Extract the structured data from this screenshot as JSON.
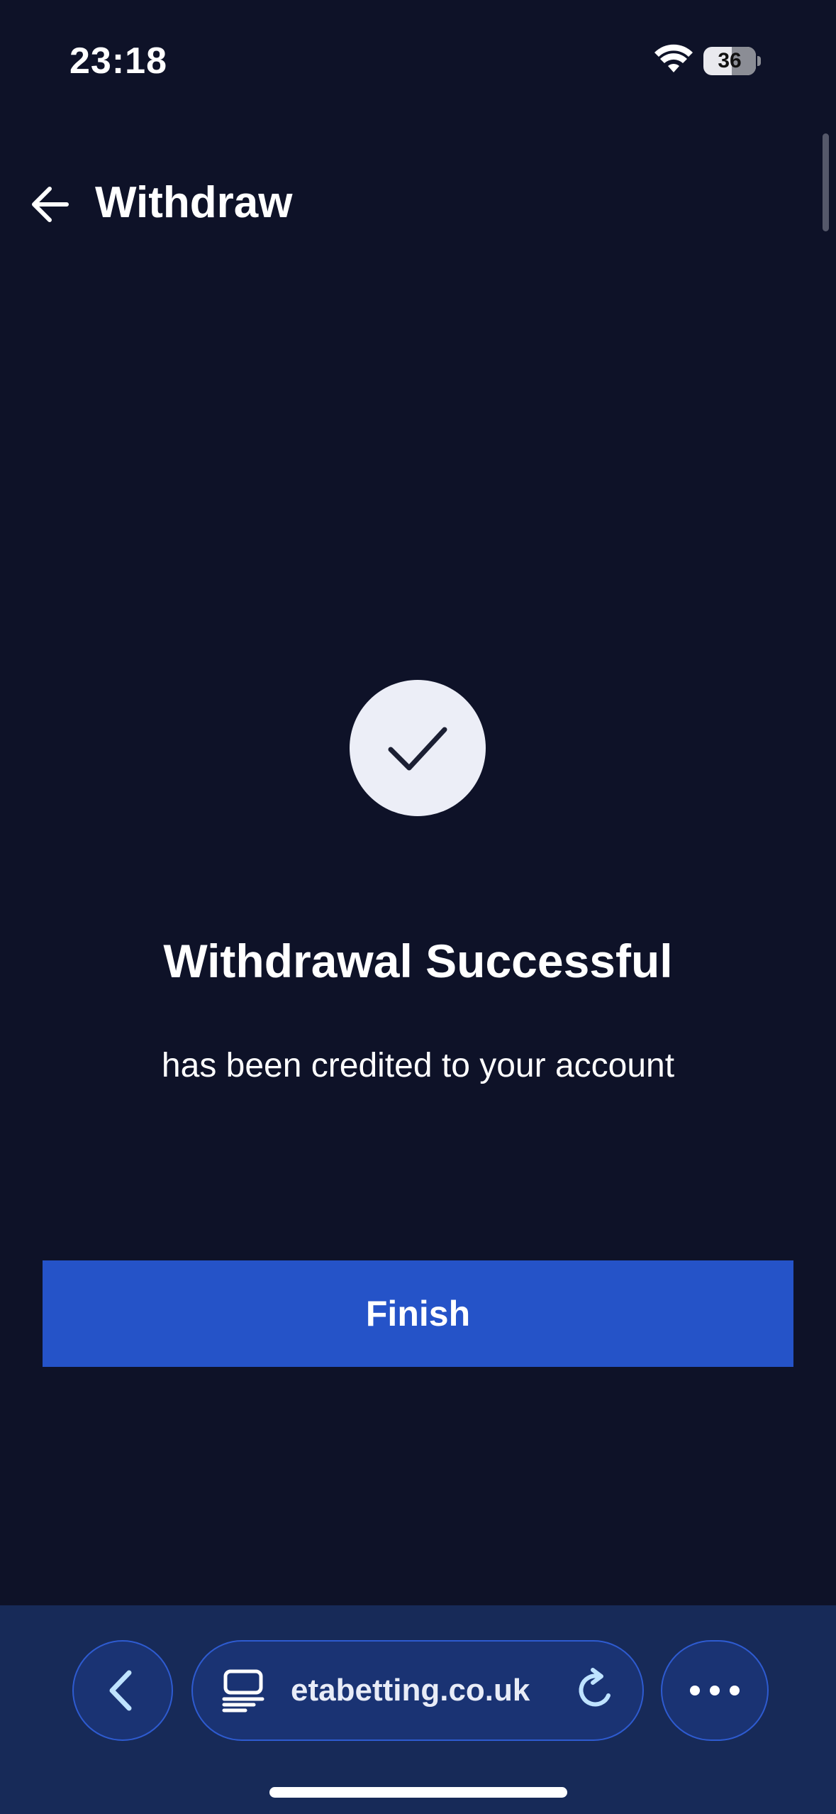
{
  "status_bar": {
    "time": "23:18",
    "battery_level": "36",
    "icons": [
      "wifi-icon",
      "battery-icon"
    ]
  },
  "header": {
    "back_icon": "arrow-left-icon",
    "title": "Withdraw"
  },
  "result": {
    "icon": "check-icon",
    "title": "Withdrawal Successful",
    "subtitle": "has been credited to your account"
  },
  "actions": {
    "finish_label": "Finish"
  },
  "browser": {
    "back_icon": "chevron-left-icon",
    "tabs_icon": "tab-overview-icon",
    "url": "etabetting.co.uk",
    "reload_icon": "reload-icon",
    "more_icon": "more-icon"
  },
  "colors": {
    "background": "#0e1228",
    "accent": "#2553c8",
    "toolbar": "#172a58",
    "success_circle": "#eceef7"
  }
}
